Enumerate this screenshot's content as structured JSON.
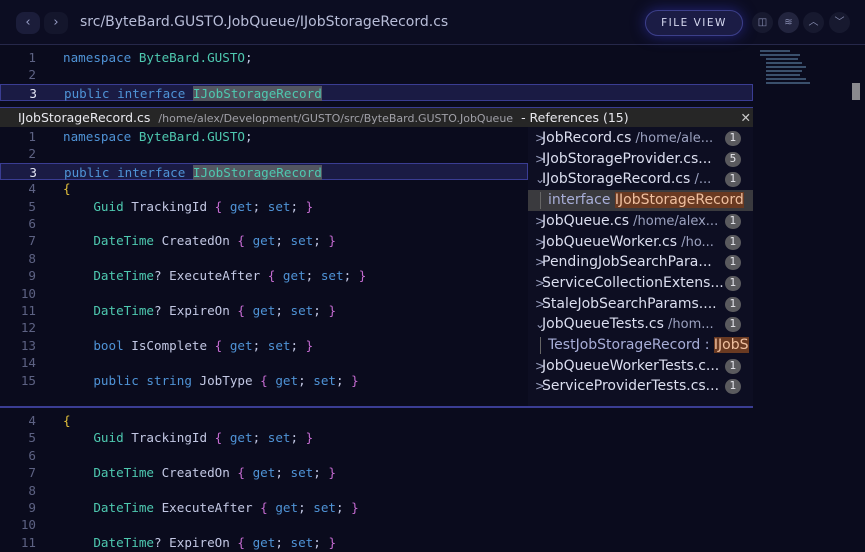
{
  "header": {
    "path": "src/ByteBard.GUSTO.JobQueue/IJobStorageRecord.cs",
    "file_view": "FILE VIEW",
    "back": "‹",
    "forward": "›",
    "icons": [
      "split-icon",
      "layers-icon",
      "chevron-up-icon",
      "chevron-down-icon"
    ],
    "icon_glyphs": [
      "◫",
      "≋",
      "︿",
      "﹀"
    ]
  },
  "editor_top": [
    {
      "n": "1",
      "t": [
        [
          "namespace ",
          "kw"
        ],
        [
          "ByteBard.GUSTO",
          "ty"
        ],
        [
          ";",
          "pn"
        ]
      ]
    },
    {
      "n": "2",
      "t": []
    },
    {
      "n": "3",
      "cur": true,
      "t": [
        [
          "public ",
          "kw"
        ],
        [
          "interface ",
          "kw"
        ],
        [
          "IJobStorageRecord",
          "ty hl"
        ]
      ]
    }
  ],
  "peek": {
    "file": "IJobStorageRecord.cs",
    "path": "/home/alex/Development/GUSTO/src/ByteBard.GUSTO.JobQueue",
    "title": "- References (15)",
    "close": "✕",
    "lines": [
      {
        "n": "1",
        "t": [
          [
            "namespace ",
            "kw"
          ],
          [
            "ByteBard.GUSTO",
            "ty"
          ],
          [
            ";",
            "pn"
          ]
        ]
      },
      {
        "n": "2",
        "t": []
      },
      {
        "n": "3",
        "cur": true,
        "t": [
          [
            "public ",
            "kw"
          ],
          [
            "interface ",
            "kw"
          ],
          [
            "IJobStorageRecord",
            "ty hl"
          ]
        ]
      },
      {
        "n": "4",
        "t": [
          [
            "{",
            "yb"
          ]
        ]
      },
      {
        "n": "5",
        "t": [
          [
            "    Guid ",
            "ty"
          ],
          [
            "TrackingId ",
            "id"
          ],
          [
            "{ ",
            "br"
          ],
          [
            "get",
            "kw"
          ],
          [
            "; ",
            "pn"
          ],
          [
            "set",
            "kw"
          ],
          [
            "; ",
            "pn"
          ],
          [
            "}",
            "br"
          ]
        ]
      },
      {
        "n": "6",
        "t": []
      },
      {
        "n": "7",
        "t": [
          [
            "    DateTime ",
            "ty"
          ],
          [
            "CreatedOn ",
            "id"
          ],
          [
            "{ ",
            "br"
          ],
          [
            "get",
            "kw"
          ],
          [
            "; ",
            "pn"
          ],
          [
            "set",
            "kw"
          ],
          [
            "; ",
            "pn"
          ],
          [
            "}",
            "br"
          ]
        ]
      },
      {
        "n": "8",
        "t": []
      },
      {
        "n": "9",
        "t": [
          [
            "    DateTime",
            "ty"
          ],
          [
            "? ",
            "pn"
          ],
          [
            "ExecuteAfter ",
            "id"
          ],
          [
            "{ ",
            "br"
          ],
          [
            "get",
            "kw"
          ],
          [
            "; ",
            "pn"
          ],
          [
            "set",
            "kw"
          ],
          [
            "; ",
            "pn"
          ],
          [
            "}",
            "br"
          ]
        ]
      },
      {
        "n": "10",
        "t": []
      },
      {
        "n": "11",
        "t": [
          [
            "    DateTime",
            "ty"
          ],
          [
            "? ",
            "pn"
          ],
          [
            "ExpireOn ",
            "id"
          ],
          [
            "{ ",
            "br"
          ],
          [
            "get",
            "kw"
          ],
          [
            "; ",
            "pn"
          ],
          [
            "set",
            "kw"
          ],
          [
            "; ",
            "pn"
          ],
          [
            "}",
            "br"
          ]
        ]
      },
      {
        "n": "12",
        "t": []
      },
      {
        "n": "13",
        "t": [
          [
            "    bool ",
            "kw"
          ],
          [
            "IsComplete ",
            "id"
          ],
          [
            "{ ",
            "br"
          ],
          [
            "get",
            "kw"
          ],
          [
            "; ",
            "pn"
          ],
          [
            "set",
            "kw"
          ],
          [
            "; ",
            "pn"
          ],
          [
            "}",
            "br"
          ]
        ]
      },
      {
        "n": "14",
        "t": []
      },
      {
        "n": "15",
        "t": [
          [
            "    public ",
            "kw"
          ],
          [
            "string ",
            "kw"
          ],
          [
            "JobType ",
            "id"
          ],
          [
            "{ ",
            "br"
          ],
          [
            "get",
            "kw"
          ],
          [
            "; ",
            "pn"
          ],
          [
            "set",
            "kw"
          ],
          [
            "; ",
            "pn"
          ],
          [
            "}",
            "br"
          ]
        ]
      }
    ],
    "references": [
      {
        "chev": ">",
        "name": "JobRecord.cs",
        "path": " /home/ale...",
        "count": "1"
      },
      {
        "chev": ">",
        "name": "IJobStorageProvider.cs...",
        "path": "",
        "count": "5"
      },
      {
        "chev": "⌄",
        "name": "IJobStorageRecord.cs",
        "path": " /...",
        "count": "1"
      },
      {
        "sub": true,
        "selected": true,
        "pre": "interface ",
        "match": "IJobStorageRecord"
      },
      {
        "chev": ">",
        "name": "JobQueue.cs",
        "path": " /home/alex...",
        "count": "1"
      },
      {
        "chev": ">",
        "name": "JobQueueWorker.cs",
        "path": " /ho...",
        "count": "1"
      },
      {
        "chev": ">",
        "name": "PendingJobSearchPara...",
        "path": "",
        "count": "1"
      },
      {
        "chev": ">",
        "name": "ServiceCollectionExtens...",
        "path": "",
        "count": "1"
      },
      {
        "chev": ">",
        "name": "StaleJobSearchParams....",
        "path": "",
        "count": "1"
      },
      {
        "chev": "⌄",
        "name": "JobQueueTests.cs",
        "path": " /hom...",
        "count": "1"
      },
      {
        "sub": true,
        "pre": "TestJobStorageRecord : ",
        "match": "IJobS"
      },
      {
        "chev": ">",
        "name": "JobQueueWorkerTests.c...",
        "path": "",
        "count": "1"
      },
      {
        "chev": ">",
        "name": "ServiceProviderTests.cs...",
        "path": "",
        "count": "1"
      }
    ]
  },
  "editor_bottom": [
    {
      "n": "4",
      "t": [
        [
          "{",
          "yb"
        ]
      ]
    },
    {
      "n": "5",
      "t": [
        [
          "    Guid ",
          "ty"
        ],
        [
          "TrackingId ",
          "id"
        ],
        [
          "{ ",
          "br"
        ],
        [
          "get",
          "kw"
        ],
        [
          "; ",
          "pn"
        ],
        [
          "set",
          "kw"
        ],
        [
          "; ",
          "pn"
        ],
        [
          "}",
          "br"
        ]
      ]
    },
    {
      "n": "6",
      "t": []
    },
    {
      "n": "7",
      "t": [
        [
          "    DateTime ",
          "ty"
        ],
        [
          "CreatedOn ",
          "id"
        ],
        [
          "{ ",
          "br"
        ],
        [
          "get",
          "kw"
        ],
        [
          "; ",
          "pn"
        ],
        [
          "set",
          "kw"
        ],
        [
          "; ",
          "pn"
        ],
        [
          "}",
          "br"
        ]
      ]
    },
    {
      "n": "8",
      "t": []
    },
    {
      "n": "9",
      "t": [
        [
          "    DateTime ",
          "ty"
        ],
        [
          "ExecuteAfter ",
          "id"
        ],
        [
          "{ ",
          "br"
        ],
        [
          "get",
          "kw"
        ],
        [
          "; ",
          "pn"
        ],
        [
          "set",
          "kw"
        ],
        [
          "; ",
          "pn"
        ],
        [
          "}",
          "br"
        ]
      ]
    },
    {
      "n": "10",
      "t": []
    },
    {
      "n": "11",
      "t": [
        [
          "    DateTime",
          "ty"
        ],
        [
          "? ",
          "pn"
        ],
        [
          "ExpireOn ",
          "id"
        ],
        [
          "{ ",
          "br"
        ],
        [
          "get",
          "kw"
        ],
        [
          "; ",
          "pn"
        ],
        [
          "set",
          "kw"
        ],
        [
          "; ",
          "pn"
        ],
        [
          "}",
          "br"
        ]
      ]
    }
  ]
}
